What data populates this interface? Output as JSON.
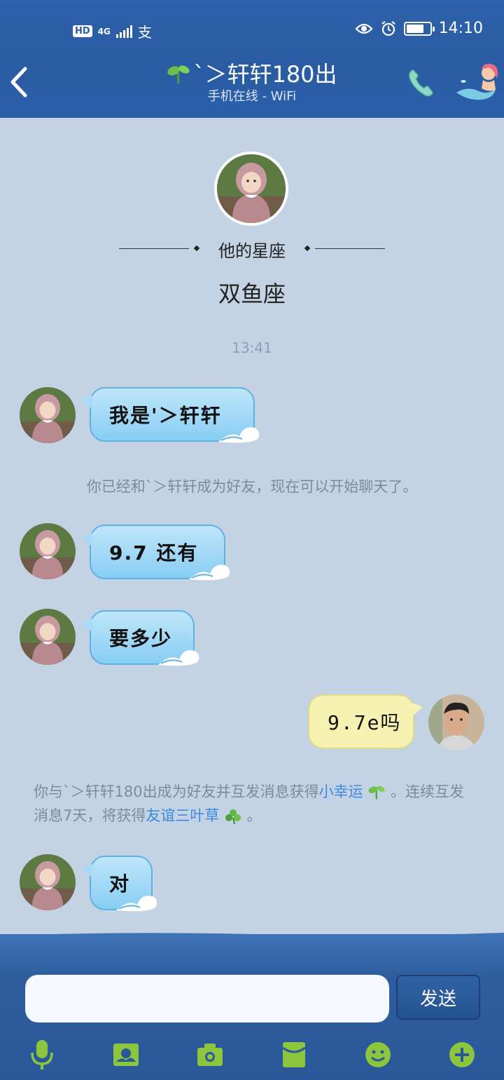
{
  "status_bar": {
    "hd": "HD",
    "network": "4G",
    "alipay_glyph": "支",
    "time": "14:10",
    "battery_level": 0.75
  },
  "header": {
    "title": "`＞轩轩180出",
    "subtitle": "手机在线 - WiFi"
  },
  "profile": {
    "zodiac_label": "他的星座",
    "zodiac_value": "双鱼座"
  },
  "timestamp": "13:41",
  "messages": [
    {
      "side": "left",
      "text": "我是'＞轩轩"
    },
    {
      "side": "left",
      "text": "9.7 还有"
    },
    {
      "side": "left",
      "text": "要多少"
    },
    {
      "side": "right",
      "text": "9.7e吗"
    },
    {
      "side": "left",
      "text": "对"
    }
  ],
  "system": {
    "friend_notice": "你已经和`＞轩轩成为好友，现在可以开始聊天了。",
    "luck_part1": "你与`＞轩轩180出成为好友并互发消息获得",
    "luck_link1": "小幸运",
    "luck_part2": "。连续互发消息7天，将获得",
    "luck_link2": "友谊三叶草",
    "luck_part3": "。"
  },
  "input": {
    "placeholder": "",
    "send_label": "发送"
  },
  "toolbar_icons": [
    "microphone-icon",
    "picture-icon",
    "camera-icon",
    "red-packet-icon",
    "emoji-icon",
    "plus-icon"
  ],
  "colors": {
    "header_bg": "#2b5fa8",
    "chat_bg": "#c4d3e3",
    "bubble_left": "#9fd6f6",
    "bubble_right": "#f6f2b2",
    "link": "#3b8ae0",
    "toolbar_icon": "#8cc63f"
  }
}
